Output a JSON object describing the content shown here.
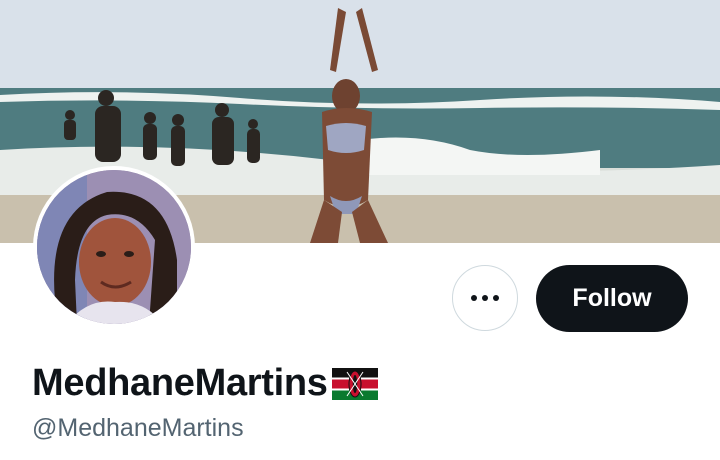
{
  "profile": {
    "display_name": "MedhaneMartins",
    "handle": "@MedhaneMartins",
    "flag_icon": "kenya-flag-icon"
  },
  "actions": {
    "follow_label": "Follow",
    "more_icon": "more-options-icon"
  },
  "colors": {
    "follow_bg": "#0f1419",
    "follow_text": "#ffffff",
    "handle_text": "#536471",
    "border": "#cfd9de"
  }
}
